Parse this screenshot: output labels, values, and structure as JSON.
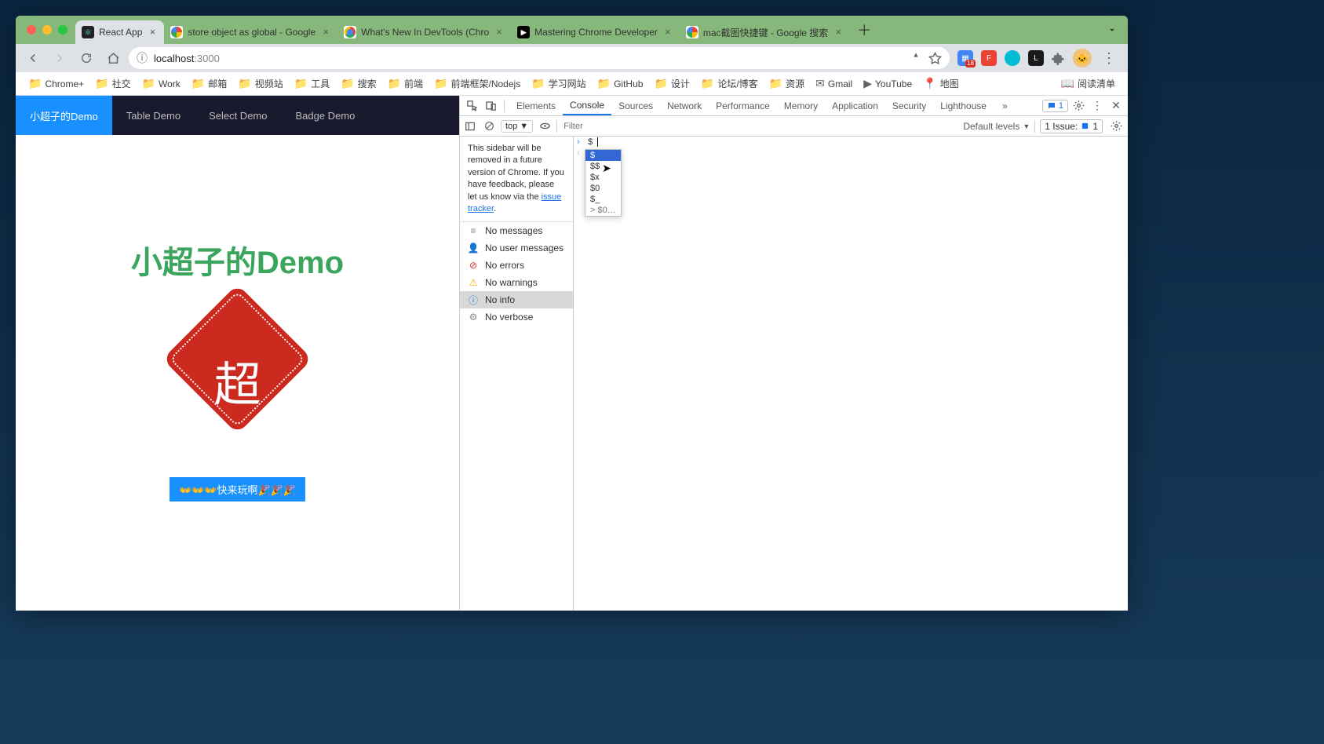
{
  "tabs": [
    {
      "title": "React App",
      "fav": "react",
      "active": true
    },
    {
      "title": "store object as global - Google",
      "fav": "g"
    },
    {
      "title": "What's New In DevTools (Chro",
      "fav": "chrome"
    },
    {
      "title": "Mastering Chrome Developer",
      "fav": "dark",
      "favText": "▶"
    },
    {
      "title": "mac截图快捷键 - Google 搜索",
      "fav": "g"
    }
  ],
  "address": {
    "site_info_icon": "ⓘ",
    "host": "localhost",
    "path": ":3000"
  },
  "ext_badge": "18",
  "bookmarks": [
    {
      "label": "Chrome+",
      "icon": "folder"
    },
    {
      "label": "社交",
      "icon": "folder"
    },
    {
      "label": "Work",
      "icon": "folder"
    },
    {
      "label": "邮箱",
      "icon": "folder"
    },
    {
      "label": "视频站",
      "icon": "folder"
    },
    {
      "label": "工具",
      "icon": "folder"
    },
    {
      "label": "搜索",
      "icon": "folder"
    },
    {
      "label": "前端",
      "icon": "folder"
    },
    {
      "label": "前端框架/Nodejs",
      "icon": "folder"
    },
    {
      "label": "学习网站",
      "icon": "folder"
    },
    {
      "label": "GitHub",
      "icon": "folder"
    },
    {
      "label": "设计",
      "icon": "folder"
    },
    {
      "label": "论坛/博客",
      "icon": "folder"
    },
    {
      "label": "资源",
      "icon": "folder"
    },
    {
      "label": "Gmail",
      "icon": "gmail"
    },
    {
      "label": "YouTube",
      "icon": "yt"
    },
    {
      "label": "地图",
      "icon": "map"
    },
    {
      "label": "阅读清单",
      "icon": "reading",
      "right": true
    }
  ],
  "page": {
    "nav": [
      {
        "label": "小超子的Demo",
        "active": true
      },
      {
        "label": "Table Demo"
      },
      {
        "label": "Select Demo"
      },
      {
        "label": "Badge Demo"
      }
    ],
    "hero_title": "小超子的Demo",
    "diamond_char": "超",
    "play_btn": "👐👐👐快来玩啊🎉🎉🎉"
  },
  "devtools": {
    "tabs": [
      "Elements",
      "Console",
      "Sources",
      "Network",
      "Performance",
      "Memory",
      "Application",
      "Security",
      "Lighthouse"
    ],
    "active_tab": "Console",
    "more": "»",
    "messages_badge": "1",
    "context": "top",
    "filter_placeholder": "Filter",
    "levels": "Default levels",
    "issues_label": "1 Issue:",
    "issues_count": "1",
    "notice": {
      "text_a": "This sidebar will be removed in a future version of Chrome. If you have feedback, please let us know via the ",
      "link": "issue tracker",
      "text_b": "."
    },
    "filters": [
      {
        "icon": "msg",
        "label": "No messages"
      },
      {
        "icon": "user",
        "label": "No user messages"
      },
      {
        "icon": "err",
        "label": "No errors"
      },
      {
        "icon": "warn",
        "label": "No warnings"
      },
      {
        "icon": "info",
        "label": "No info",
        "selected": true
      },
      {
        "icon": "verb",
        "label": "No verbose"
      }
    ],
    "console_input": "$",
    "autocomplete": [
      {
        "label": "$",
        "selected": true
      },
      {
        "label": "$$"
      },
      {
        "label": "$x"
      },
      {
        "label": "$0"
      },
      {
        "label": "$_"
      },
      {
        "label": "> $0…",
        "last": true
      }
    ]
  }
}
